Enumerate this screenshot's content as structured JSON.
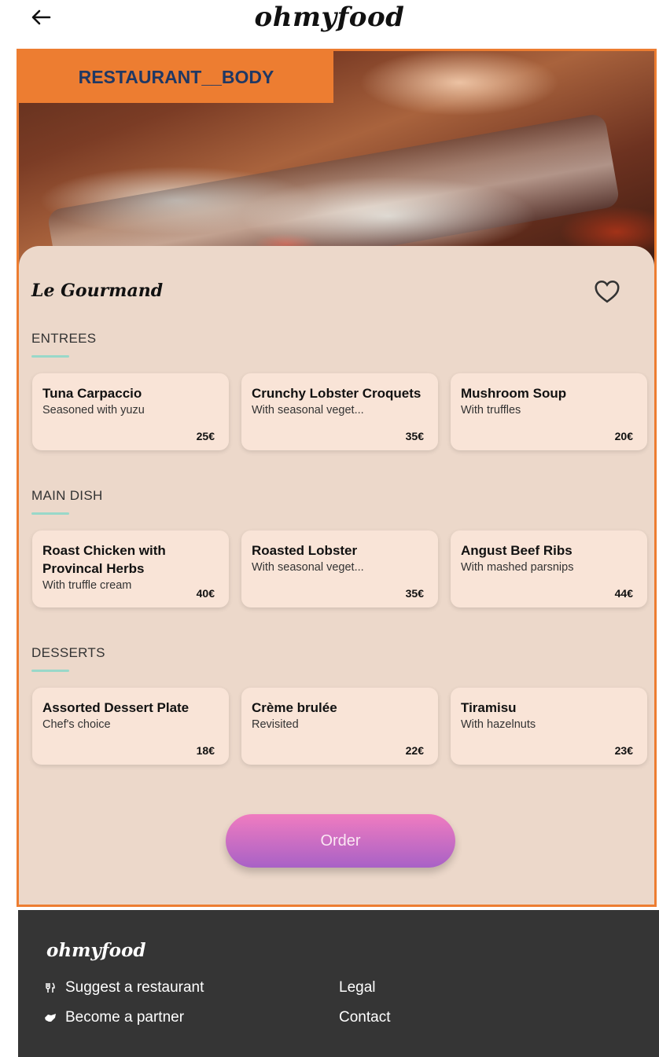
{
  "header": {
    "logo": "ohmyfood"
  },
  "annotation_label": "RESTAURANT__BODY",
  "restaurant": {
    "name": "Le Gourmand"
  },
  "sections": [
    {
      "title": "ENTREES",
      "dishes": [
        {
          "name": "Tuna Carpaccio",
          "desc": "Seasoned with yuzu",
          "price": "25€"
        },
        {
          "name": "Crunchy Lobster Croquets",
          "desc": "With seasonal veget...",
          "price": "35€"
        },
        {
          "name": "Mushroom Soup",
          "desc": "With truffles",
          "price": "20€"
        }
      ]
    },
    {
      "title": "MAIN DISH",
      "dishes": [
        {
          "name": "Roast Chicken with Provincal Herbs",
          "desc": "With truffle cream",
          "price": "40€"
        },
        {
          "name": "Roasted Lobster",
          "desc": "With seasonal veget...",
          "price": "35€"
        },
        {
          "name": "Angust Beef Ribs",
          "desc": "With mashed parsnips",
          "price": "44€"
        }
      ]
    },
    {
      "title": "DESSERTS",
      "dishes": [
        {
          "name": "Assorted Dessert Plate",
          "desc": "Chef's choice",
          "price": "18€"
        },
        {
          "name": "Crème brulée",
          "desc": "Revisited",
          "price": "22€"
        },
        {
          "name": "Tiramisu",
          "desc": "With hazelnuts",
          "price": "23€"
        }
      ]
    }
  ],
  "order_label": "Order",
  "footer": {
    "logo": "ohmyfood",
    "suggest": "Suggest a restaurant",
    "partner": "Become a partner",
    "legal": "Legal",
    "contact": "Contact"
  },
  "colors": {
    "accent_orange": "#ed7d31",
    "panel_bg": "#ecd8ca",
    "card_bg": "#f9e4d7",
    "underline_teal": "#99d8c9",
    "order_top": "#f07cc0",
    "order_bottom": "#a861c6",
    "footer_bg": "#353535"
  },
  "icons": {
    "back": "arrow-left-icon",
    "favorite": "heart-outline-icon",
    "suggest": "fork-knife-icon",
    "partner": "handshake-icon"
  }
}
